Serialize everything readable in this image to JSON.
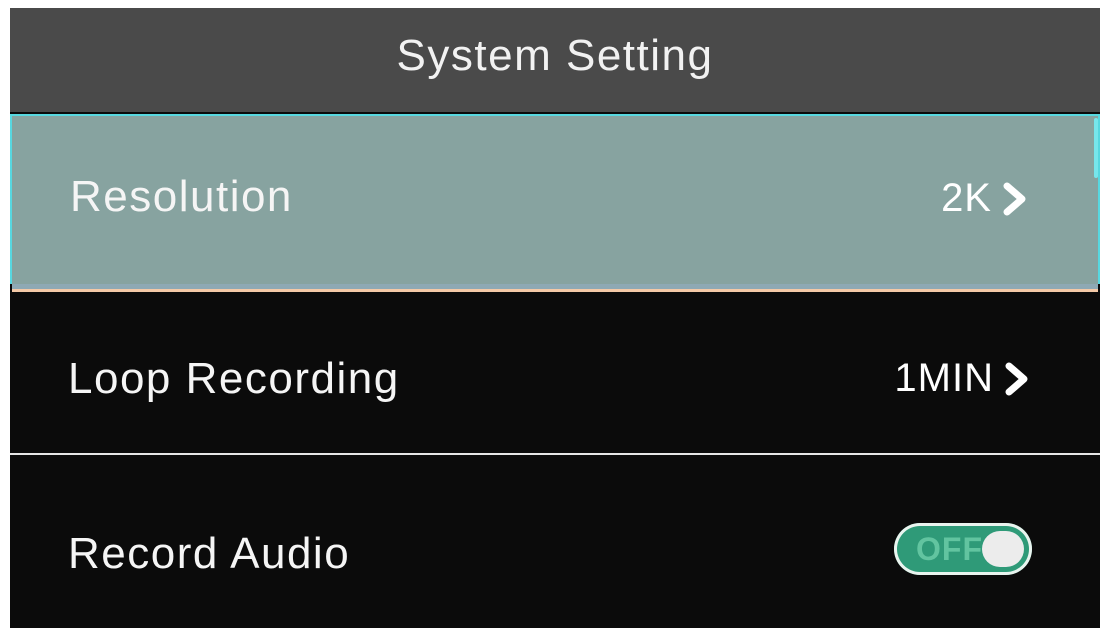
{
  "header": {
    "title": "System Setting"
  },
  "menu": {
    "items": [
      {
        "label": "Resolution",
        "value": "2K",
        "chevron_icon": "chevron-right-icon",
        "selected": true
      },
      {
        "label": "Loop Recording",
        "value": "1MIN",
        "chevron_icon": "chevron-right-icon",
        "selected": false
      },
      {
        "label": "Record Audio",
        "toggle_text": "OFF",
        "toggle_on": false,
        "selected": false
      }
    ]
  },
  "colors": {
    "title_bar": "#4a4a4a",
    "background": "#0b0b0b",
    "selected_row": "#87a3a0",
    "selection_border": "#57d8e0",
    "toggle_green": "#2f9a78",
    "text": "#f5f5f5"
  }
}
